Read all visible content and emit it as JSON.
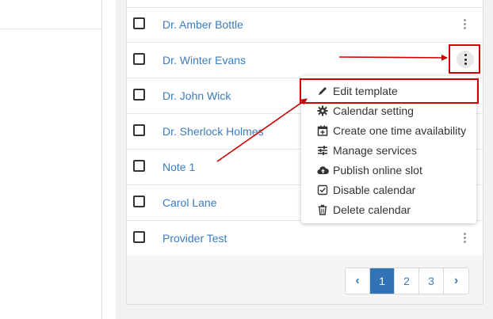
{
  "providers": [
    {
      "label": "Dr. Amber Bottle"
    },
    {
      "label": "Dr. Winter Evans"
    },
    {
      "label": "Dr. John Wick"
    },
    {
      "label": "Dr. Sherlock Holmes"
    },
    {
      "label": "Note 1"
    },
    {
      "label": "Carol Lane"
    },
    {
      "label": "Provider Test"
    }
  ],
  "menu": {
    "items": [
      {
        "label": "Edit template",
        "icon": "pencil-icon"
      },
      {
        "label": "Calendar setting",
        "icon": "gear-icon"
      },
      {
        "label": "Create one time availability",
        "icon": "calendar-plus-icon"
      },
      {
        "label": "Manage services",
        "icon": "sliders-icon"
      },
      {
        "label": "Publish online slot",
        "icon": "cloud-upload-icon"
      },
      {
        "label": "Disable calendar",
        "icon": "checkbox-icon"
      },
      {
        "label": "Delete calendar",
        "icon": "trash-icon"
      }
    ]
  },
  "pagination": {
    "prev": "‹",
    "pages": [
      "1",
      "2",
      "3"
    ],
    "current": "1",
    "next": "›"
  },
  "colors": {
    "link": "#3c7bbd",
    "active_page": "#3173b5",
    "annotation": "#d00000"
  }
}
